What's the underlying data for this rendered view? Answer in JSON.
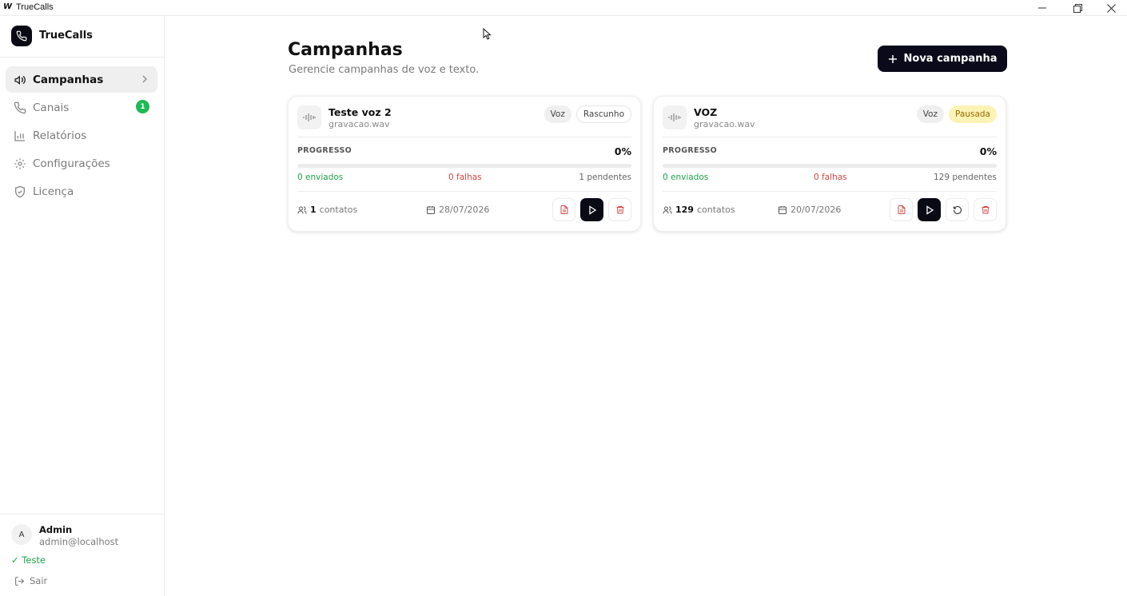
{
  "window": {
    "logo_glyph": "W",
    "title": "TrueCalls"
  },
  "sidebar": {
    "brand": "TrueCalls",
    "items": [
      {
        "label": "Campanhas",
        "icon": "megaphone-icon",
        "active": true
      },
      {
        "label": "Canais",
        "icon": "phone-icon",
        "badge": "1"
      },
      {
        "label": "Relatórios",
        "icon": "bar-chart-icon"
      },
      {
        "label": "Configurações",
        "icon": "gear-icon"
      },
      {
        "label": "Licença",
        "icon": "shield-check-icon"
      }
    ],
    "user": {
      "initial": "A",
      "name": "Admin",
      "email": "admin@localhost",
      "license": "✓ Teste",
      "logout": "Sair"
    }
  },
  "main": {
    "title": "Campanhas",
    "subtitle": "Gerencie campanhas de voz e texto.",
    "new_button": "Nova campanha"
  },
  "campaigns": [
    {
      "name": "Teste voz 2",
      "file": "gravacao.wav",
      "type": "Voz",
      "status": "Rascunho",
      "progress_label": "PROGRESSO",
      "progress_text": "0%",
      "progress": 0,
      "sent": "0 enviados",
      "failed": "0 falhas",
      "pending": "1 pendentes",
      "contacts_count": "1",
      "contacts_label": "contatos",
      "date": "28/07/2026"
    },
    {
      "name": "VOZ",
      "file": "gravacao.wav",
      "type": "Voz",
      "status": "Pausada",
      "progress_label": "PROGRESSO",
      "progress_text": "0%",
      "progress": 0,
      "sent": "0 enviados",
      "failed": "0 falhas",
      "pending": "129 pendentes",
      "contacts_count": "129",
      "contacts_label": "contatos",
      "date": "20/07/2026"
    }
  ],
  "colors": {
    "accent": "#0a0a14",
    "success": "#1ea34a",
    "danger": "#d64545",
    "paused_bg": "#fdf3b5"
  }
}
